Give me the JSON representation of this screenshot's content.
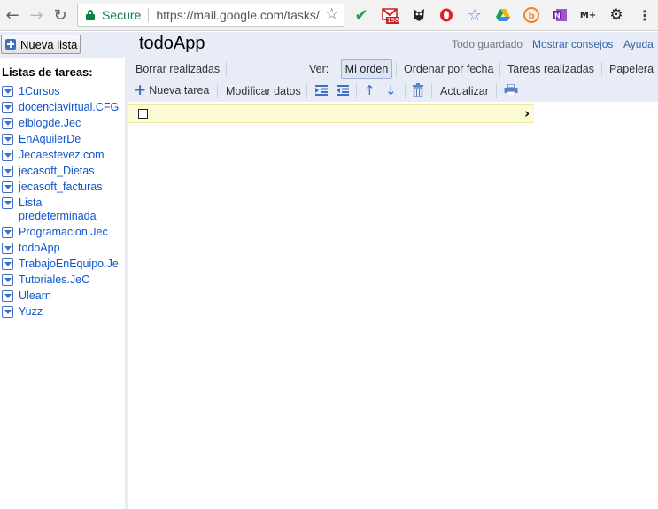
{
  "browser": {
    "secure_label": "Secure",
    "url": "https://mail.google.com/tasks/",
    "gmail_badge": "198"
  },
  "header": {
    "new_list_label": "Nueva lista",
    "title": "todoApp",
    "saved_status": "Todo guardado",
    "tips_link": "Mostrar consejos",
    "help_link": "Ayuda"
  },
  "sidebar": {
    "title": "Listas de tareas:",
    "lists": [
      "1Cursos",
      "docenciavirtual.CFG",
      "elblogde.Jec",
      "EnAquilerDe",
      "Jecaestevez.com",
      "jecasoft_Dietas",
      "jecasoft_facturas",
      "Lista predeterminada",
      "Programacion.Jec",
      "todoApp",
      "TrabajoEnEquipo.Je",
      "Tutoriales.JeC",
      "Ulearn",
      "Yuzz"
    ]
  },
  "toolbar": {
    "clear_done": "Borrar realizadas",
    "view_label": "Ver:",
    "my_order": "Mi orden",
    "sort_date": "Ordenar por fecha",
    "done_tasks": "Tareas realizadas",
    "trash": "Papelera",
    "new_task": "Nueva tarea",
    "edit_details": "Modificar datos",
    "refresh": "Actualizar"
  },
  "colors": {
    "accent": "#3f6fc4",
    "link": "#1155cc",
    "toolbar_bg": "#e7ecf7",
    "task_highlight": "#fdfbd6"
  }
}
